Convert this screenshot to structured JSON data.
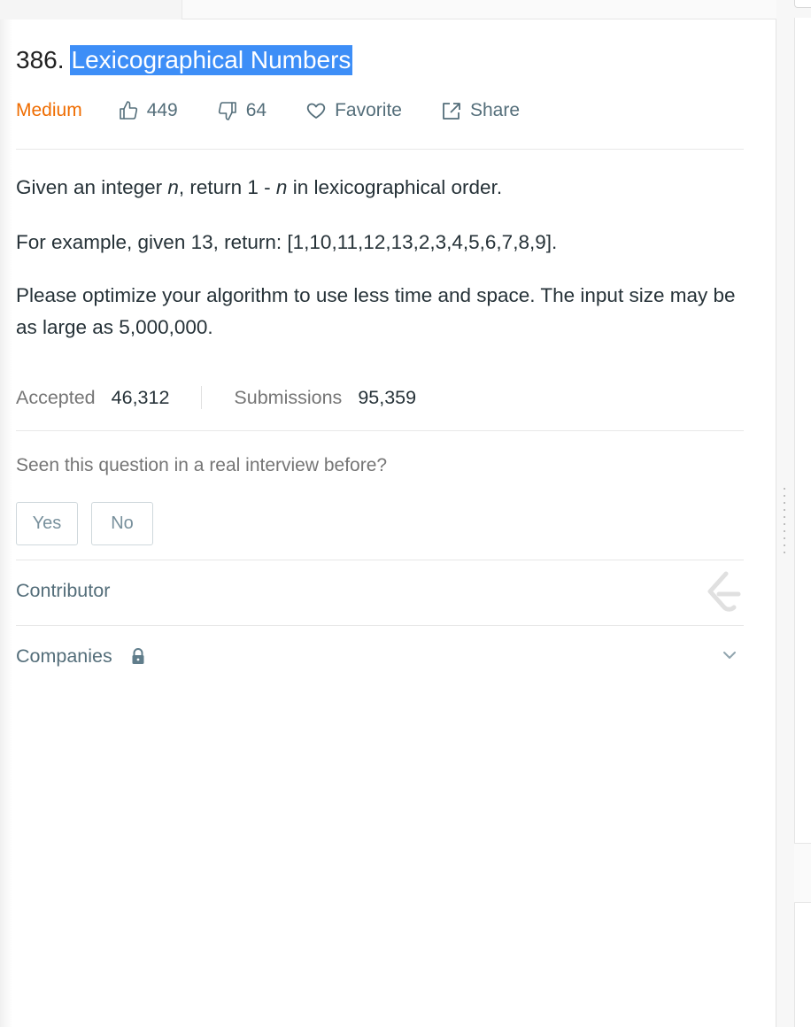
{
  "problem": {
    "number": "386.",
    "title": "Lexicographical Numbers",
    "difficulty": "Medium",
    "likes": "449",
    "dislikes": "64",
    "favorite_label": "Favorite",
    "share_label": "Share"
  },
  "description": {
    "p1_a": "Given an integer ",
    "p1_var1": "n",
    "p1_b": ", return 1 - ",
    "p1_var2": "n",
    "p1_c": " in lexicographical order.",
    "p2": "For example, given 13, return: [1,10,11,12,13,2,3,4,5,6,7,8,9].",
    "p3": "Please optimize your algorithm to use less time and space. The input size may be as large as 5,000,000."
  },
  "stats": {
    "accepted_label": "Accepted",
    "accepted_value": "46,312",
    "submissions_label": "Submissions",
    "submissions_value": "95,359"
  },
  "interview": {
    "question": "Seen this question in a real interview before?",
    "yes_label": "Yes",
    "no_label": "No"
  },
  "sections": {
    "contributor_label": "Contributor",
    "companies_label": "Companies"
  },
  "icons": {
    "like": "thumbs-up-icon",
    "dislike": "thumbs-down-icon",
    "favorite": "heart-icon",
    "share": "share-icon",
    "lock": "lock-icon",
    "logo": "leetcode-logo-icon",
    "expand": "chevron-down-icon"
  },
  "colors": {
    "difficulty_medium": "#ef6c00",
    "title_highlight": "#3d8ef7",
    "muted_text": "#546e7a"
  }
}
